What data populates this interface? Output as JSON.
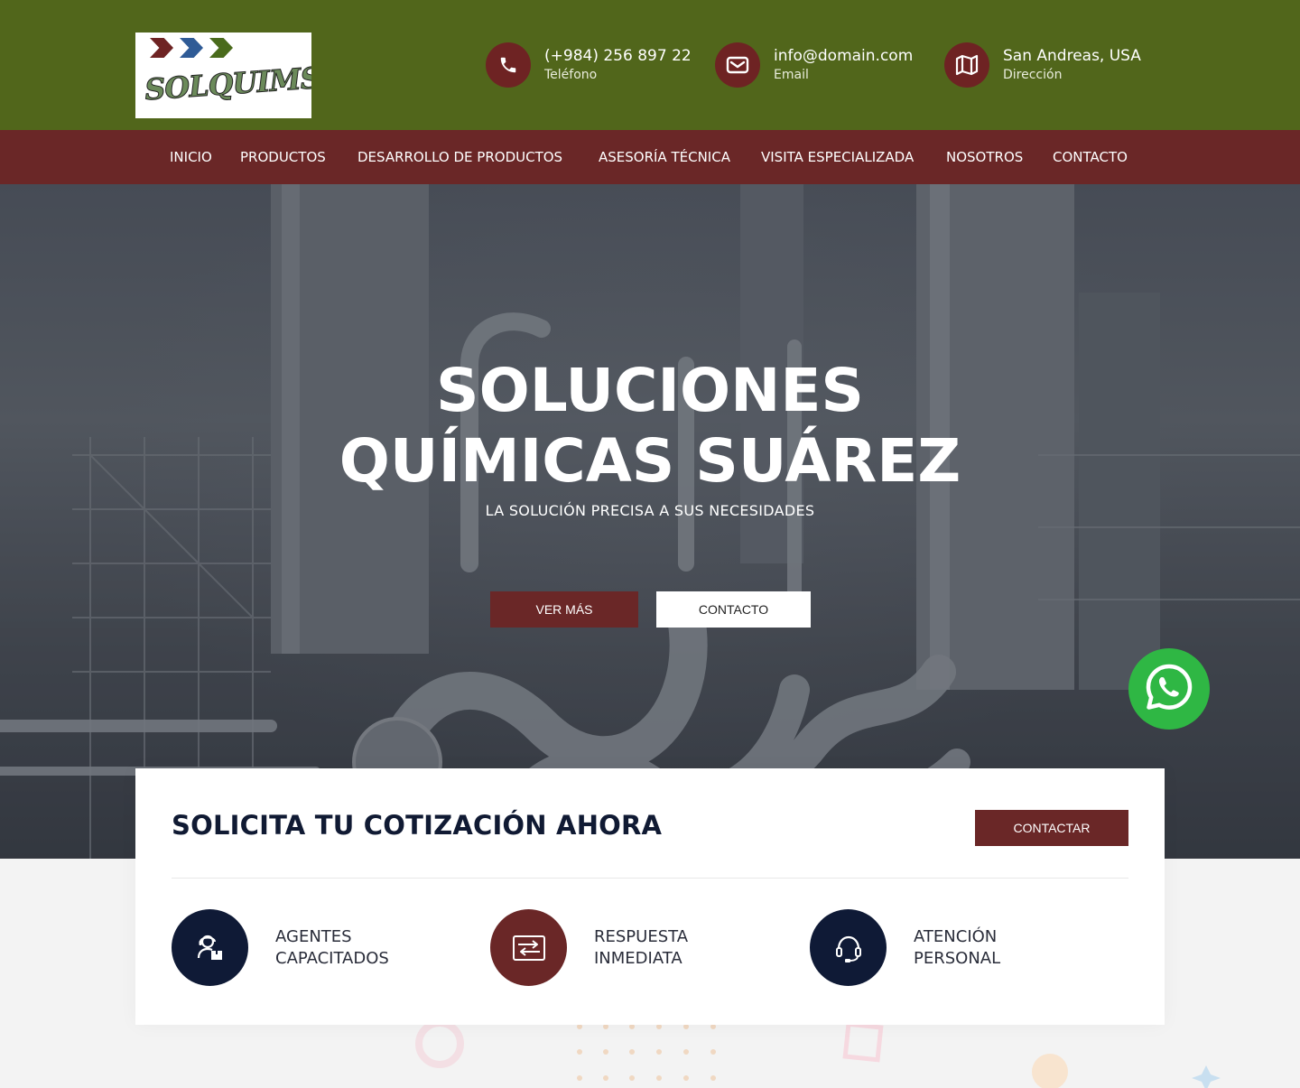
{
  "brand": {
    "logo_text": "SOLQUIMSUA",
    "colors": {
      "header_green": "#51661b",
      "accent_maroon": "#6a2727",
      "navy": "#0f1a36",
      "whatsapp_green": "#2fb744"
    }
  },
  "header": {
    "phone": {
      "value": "(+984) 256 897 22",
      "label": "Teléfono",
      "icon": "phone-icon"
    },
    "email": {
      "value": "info@domain.com",
      "label": "Email",
      "icon": "envelope-icon"
    },
    "address": {
      "value": "San Andreas, USA",
      "label": "Dirección",
      "icon": "map-icon"
    }
  },
  "nav": {
    "items": [
      {
        "label": "INICIO"
      },
      {
        "label": "PRODUCTOS"
      },
      {
        "label": "DESARROLLO DE PRODUCTOS"
      },
      {
        "label": "ASESORÍA TÉCNICA"
      },
      {
        "label": "VISITA ESPECIALIZADA"
      },
      {
        "label": "NOSOTROS"
      },
      {
        "label": "CONTACTO"
      }
    ]
  },
  "hero": {
    "title_line1": "SOLUCIONES",
    "title_line2": "QUÍMICAS SUÁREZ",
    "subtitle": "LA SOLUCIÓN PRECISA A SUS NECESIDADES",
    "primary_button": "VER MÁS",
    "secondary_button": "CONTACTO"
  },
  "quote": {
    "title": "SOLICITA TU COTIZACIÓN AHORA",
    "button": "CONTACTAR",
    "features": [
      {
        "line1": "AGENTES",
        "line2": "CAPACITADOS",
        "icon": "agent-box-icon"
      },
      {
        "line1": "RESPUESTA",
        "line2": "INMEDIATA",
        "icon": "transfer-icon"
      },
      {
        "line1": "ATENCIÓN",
        "line2": "PERSONAL",
        "icon": "headset-icon"
      }
    ]
  },
  "floating": {
    "whatsapp_icon": "whatsapp-icon"
  }
}
